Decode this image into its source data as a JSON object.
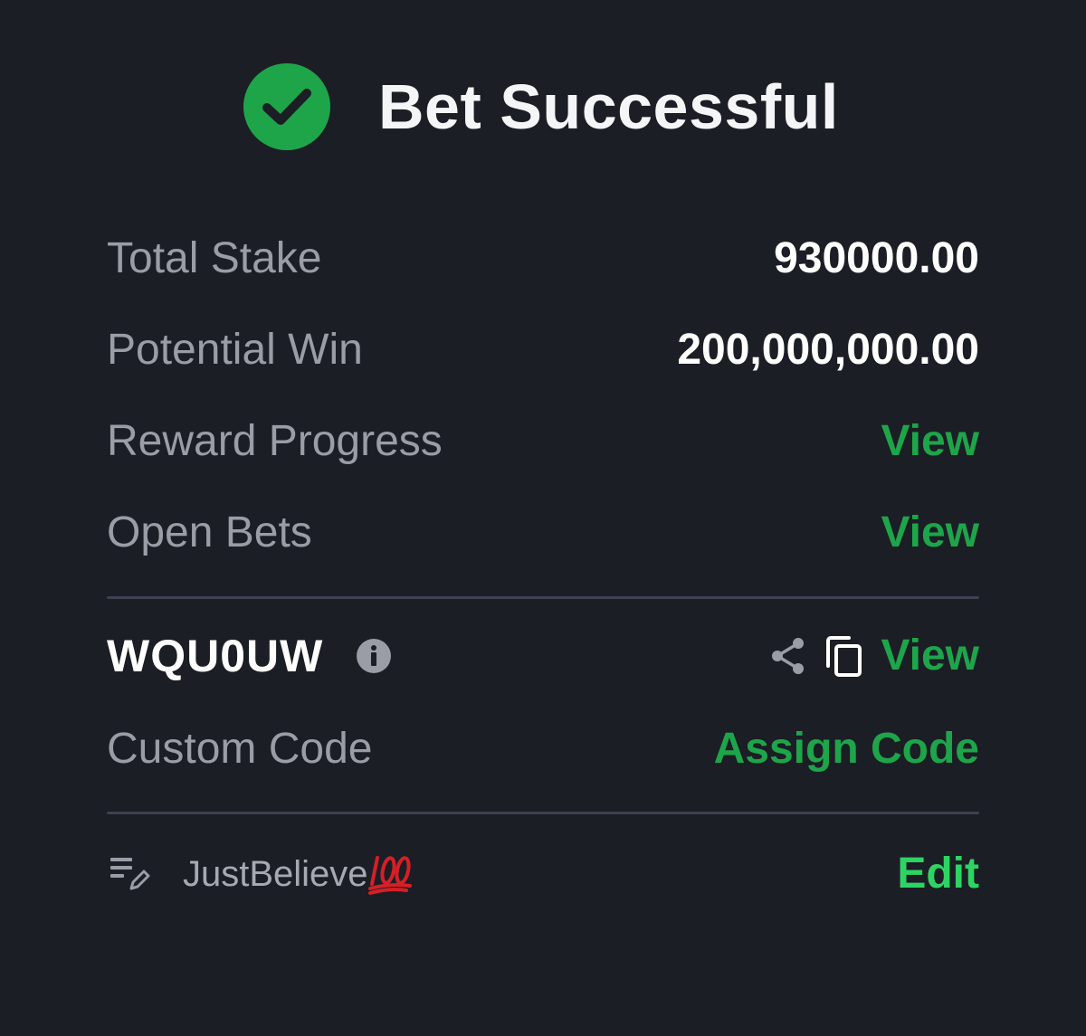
{
  "header": {
    "title": "Bet Successful",
    "icon": "check-circle-icon"
  },
  "summary": {
    "total_stake_label": "Total Stake",
    "total_stake_value": "930000.00",
    "potential_win_label": "Potential Win",
    "potential_win_value": "200,000,000.00",
    "reward_progress_label": "Reward Progress",
    "reward_progress_link": "View",
    "open_bets_label": "Open Bets",
    "open_bets_link": "View"
  },
  "booking": {
    "code": "WQU0UW",
    "view_link": "View",
    "custom_code_label": "Custom Code",
    "assign_code_link": "Assign Code"
  },
  "note": {
    "text": "JustBelieve",
    "emoji": "hundred-points-emoji",
    "edit_label": "Edit"
  },
  "colors": {
    "background": "#1b1e25",
    "accent_green": "#1ea54a",
    "edit_green": "#2ed463",
    "label_gray": "#9a9da6",
    "divider": "#3e4150"
  }
}
